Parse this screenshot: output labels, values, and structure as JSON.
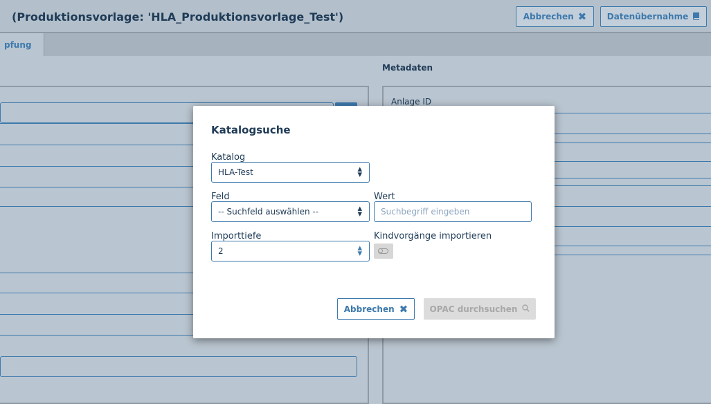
{
  "header": {
    "title": "(Produktionsvorlage: 'HLA_Produktionsvorlage_Test')",
    "cancel_label": "Abbrechen",
    "cancel_icon": "close-icon",
    "import_label": "Datenübernahme",
    "import_icon": "book-icon"
  },
  "tabs": {
    "active_label": "pfung"
  },
  "metadata_panel": {
    "title": "Metadaten",
    "first_field_label": "Anlage ID"
  },
  "colors": {
    "accent": "#3d79ad",
    "text": "#1f3b57",
    "disabled": "#dcdcdc"
  },
  "dialog": {
    "title": "Katalogsuche",
    "catalog": {
      "label": "Katalog",
      "value": "HLA-Test"
    },
    "field": {
      "label": "Feld",
      "value": "-- Suchfeld auswählen --"
    },
    "value": {
      "label": "Wert",
      "placeholder": "Suchbegriff eingeben"
    },
    "depth": {
      "label": "Importtiefe",
      "value": "2"
    },
    "child_import": {
      "label": "Kindvorgänge importieren",
      "enabled": false
    },
    "cancel_label": "Abbrechen",
    "search_label": "OPAC durchsuchen",
    "search_icon": "search-icon"
  }
}
